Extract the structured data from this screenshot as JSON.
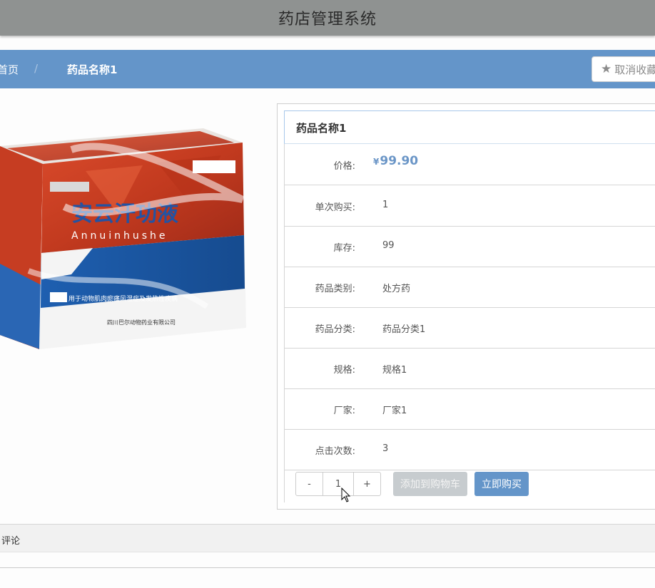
{
  "app": {
    "title": "药店管理系统"
  },
  "breadcrumb": {
    "home": "首页",
    "separator": "/",
    "current": "药品名称1"
  },
  "favorite": {
    "icon": "star-icon",
    "label": "取消收藏"
  },
  "product": {
    "name": "药品名称1",
    "price_symbol": "¥",
    "price": "99.90",
    "rows": [
      {
        "label": "单次购买:",
        "value": "1"
      },
      {
        "label": "库存:",
        "value": "99"
      },
      {
        "label": "药品类别:",
        "value": "处方药"
      },
      {
        "label": "药品分类:",
        "value": "药品分类1"
      },
      {
        "label": "规格:",
        "value": "规格1"
      },
      {
        "label": "厂家:",
        "value": "厂家1"
      },
      {
        "label": "点击次数:",
        "value": "3"
      }
    ],
    "price_label": "价格:"
  },
  "quantity": {
    "minus": "-",
    "value": "1",
    "plus": "+"
  },
  "buttons": {
    "add_to_cart": "添加到购物车",
    "buy_now": "立即购买"
  },
  "comments": {
    "label": "评论"
  },
  "colors": {
    "accent": "#6495c9",
    "topbar": "#8f9291",
    "disabled": "#c7cccf"
  }
}
